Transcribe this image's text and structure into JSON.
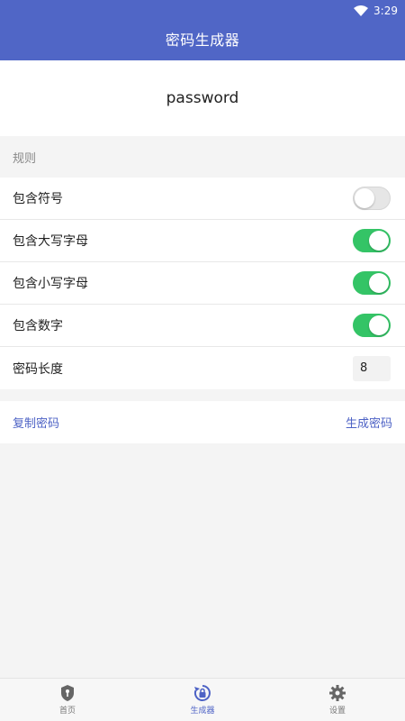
{
  "status_bar": {
    "time": "3:29",
    "wifi_icon": "wifi-icon",
    "battery_icon": "battery-icon"
  },
  "app_bar": {
    "title": "密码生成器"
  },
  "password": {
    "value": "password"
  },
  "rules": {
    "header": "规则",
    "items": [
      {
        "label": "包含符号",
        "type": "toggle",
        "enabled": false
      },
      {
        "label": "包含大写字母",
        "type": "toggle",
        "enabled": true
      },
      {
        "label": "包含小写字母",
        "type": "toggle",
        "enabled": true
      },
      {
        "label": "包含数字",
        "type": "toggle",
        "enabled": true
      },
      {
        "label": "密码长度",
        "type": "number",
        "value": "8"
      }
    ]
  },
  "actions": {
    "copy_label": "复制密码",
    "generate_label": "生成密码"
  },
  "tabs": [
    {
      "label": "首页",
      "icon": "shield-icon",
      "active": false
    },
    {
      "label": "生成器",
      "icon": "refresh-lock-icon",
      "active": true
    },
    {
      "label": "设置",
      "icon": "gear-icon",
      "active": false
    }
  ],
  "colors": {
    "primary": "#5066c6",
    "toggle_on": "#34c466",
    "link": "#4d62c5",
    "background": "#f4f4f4"
  }
}
